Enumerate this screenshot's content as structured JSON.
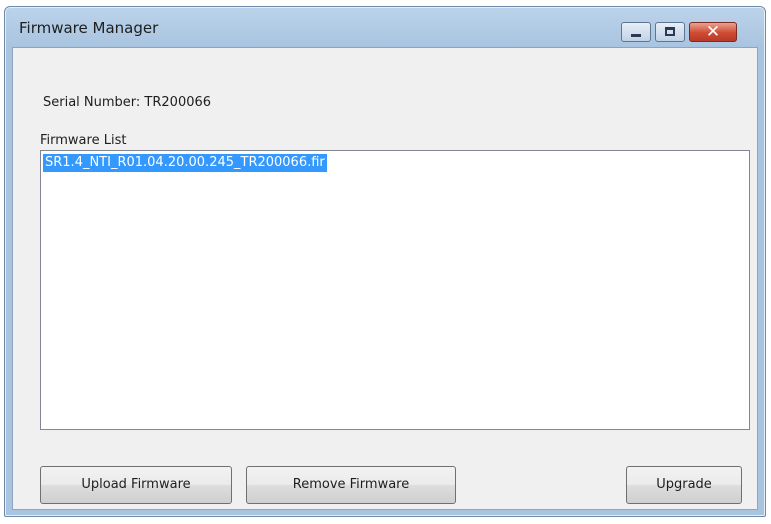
{
  "window": {
    "title": "Firmware Manager",
    "close_symbol": "✕"
  },
  "device": {
    "serial_label": "Serial Number: TR200066"
  },
  "firmware_list": {
    "label": "Firmware List",
    "items": [
      {
        "name": "SR1.4_NTI_R01.04.20.00.245_TR200066.fir",
        "selected": true
      }
    ]
  },
  "buttons": {
    "upload": "Upload Firmware",
    "remove": "Remove Firmware",
    "upgrade": "Upgrade"
  },
  "colors": {
    "selection": "#3399ff",
    "close_button": "#cf4b34",
    "title_bar": "#a9c4e0"
  },
  "icons": [
    "minimize-icon",
    "maximize-icon",
    "close-icon"
  ]
}
